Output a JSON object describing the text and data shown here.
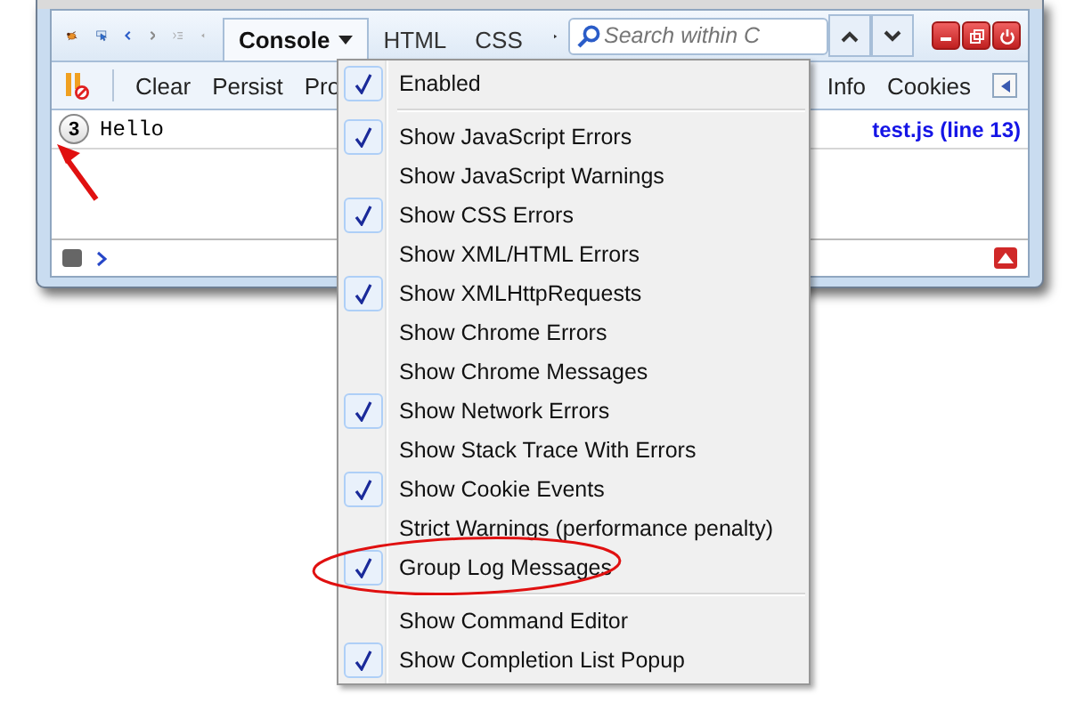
{
  "toolbar": {
    "tabs": [
      {
        "label": "Console",
        "selected": true
      },
      {
        "label": "HTML",
        "selected": false
      },
      {
        "label": "CSS",
        "selected": false
      }
    ],
    "search": {
      "placeholder": "Search within C"
    }
  },
  "console_toolbar": {
    "left": [
      "Clear",
      "Persist",
      "Pro"
    ],
    "right": [
      "Info",
      "Cookies"
    ]
  },
  "log": [
    {
      "count": "3",
      "message": "Hello",
      "source": "test.js (line 13)"
    }
  ],
  "menu": [
    {
      "kind": "item",
      "label": "Enabled",
      "checked": true
    },
    {
      "kind": "separator"
    },
    {
      "kind": "item",
      "label": "Show JavaScript Errors",
      "checked": true
    },
    {
      "kind": "item",
      "label": "Show JavaScript Warnings",
      "checked": false
    },
    {
      "kind": "item",
      "label": "Show CSS Errors",
      "checked": true
    },
    {
      "kind": "item",
      "label": "Show XML/HTML Errors",
      "checked": false
    },
    {
      "kind": "item",
      "label": "Show XMLHttpRequests",
      "checked": true
    },
    {
      "kind": "item",
      "label": "Show Chrome Errors",
      "checked": false
    },
    {
      "kind": "item",
      "label": "Show Chrome Messages",
      "checked": false
    },
    {
      "kind": "item",
      "label": "Show Network Errors",
      "checked": true
    },
    {
      "kind": "item",
      "label": "Show Stack Trace With Errors",
      "checked": false
    },
    {
      "kind": "item",
      "label": "Show Cookie Events",
      "checked": true
    },
    {
      "kind": "item",
      "label": "Strict Warnings (performance penalty)",
      "checked": false
    },
    {
      "kind": "item",
      "label": "Group Log Messages",
      "checked": true
    },
    {
      "kind": "separator"
    },
    {
      "kind": "item",
      "label": "Show Command Editor",
      "checked": false
    },
    {
      "kind": "item",
      "label": "Show Completion List Popup",
      "checked": true
    }
  ]
}
